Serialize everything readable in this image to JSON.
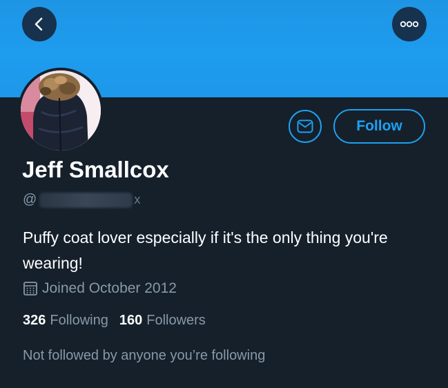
{
  "header": {
    "back_icon": "chevron-left-icon",
    "more_icon": "more-dots-icon",
    "banner_color": "#1e9cef"
  },
  "profile": {
    "display_name": "Jeff Smallcox",
    "handle_prefix": "@",
    "handle_tail": "x",
    "bio": "Puffy coat lover especially if it's the only thing you're wearing!",
    "joined": "Joined October 2012",
    "following_count": "326",
    "following_label": "Following",
    "followers_count": "160",
    "followers_label": "Followers",
    "mutuals_text": "Not followed by anyone you’re following"
  },
  "actions": {
    "follow_label": "Follow",
    "message_icon": "envelope-icon"
  },
  "colors": {
    "background": "#15202b",
    "accent": "#1da1f2",
    "secondary_text": "#8899a6"
  }
}
